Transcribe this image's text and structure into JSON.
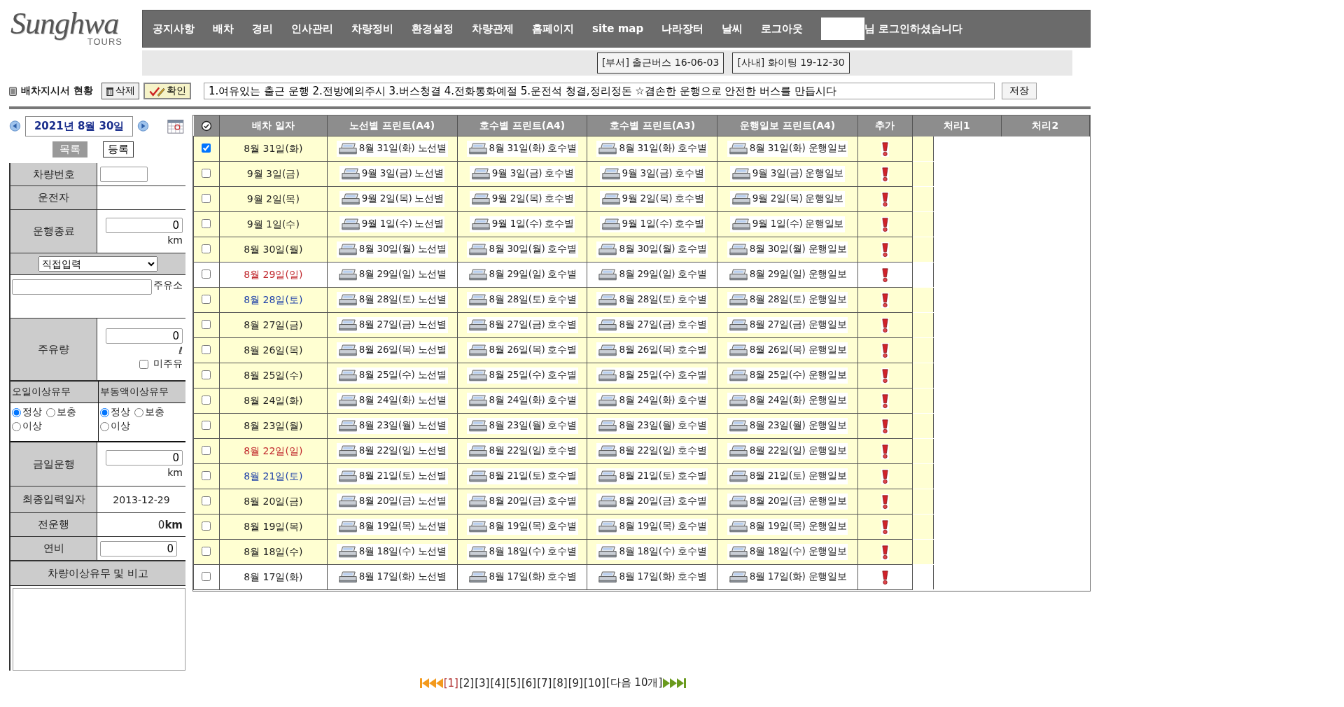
{
  "logo": {
    "name": "Sunghwa",
    "sub": "TOURS"
  },
  "nav": {
    "items": [
      "공지사항",
      "배차",
      "경리",
      "인사관리",
      "차량정비",
      "환경설정",
      "차량관제",
      "홈페이지",
      "site map",
      "나라장터",
      "날씨",
      "로그아웃"
    ],
    "login_text": "님 로그인하셨습니다"
  },
  "notices": [
    "[부서] 출근버스 16-06-03",
    "[사내] 화이팅 19-12-30"
  ],
  "toolbar": {
    "title": "배차지시서 현황",
    "delete": "삭제",
    "confirm": "확인",
    "motto": "1.여유있는 출근 운행 2.전방예의주시 3.버스청결 4.전화통화예절 5.운전석 청결,정리정돈 ☆겸손한 운행으로 안전한 버스를 만듭시다",
    "save": "저장"
  },
  "sidebar": {
    "date": "2021년 8월 30일",
    "list_button": "목록",
    "register_button": "등록",
    "vehicle_label": "차량번호",
    "driver_label": "운전자",
    "end_label": "운행종료",
    "end_value": "0",
    "end_unit": "km",
    "station_select": "직접입력",
    "station_suffix": "주유소",
    "fuel_label": "주유량",
    "fuel_value": "0",
    "fuel_unit": "ℓ",
    "no_fuel": {
      "label": "미주유",
      "checked": false
    },
    "checks": [
      {
        "title": "오일이상유무",
        "options": [
          {
            "label": "정상",
            "selected": true
          },
          {
            "label": "보충",
            "selected": false
          },
          {
            "label": "이상",
            "selected": false
          }
        ]
      },
      {
        "title": "부동액이상유무",
        "options": [
          {
            "label": "정상",
            "selected": true
          },
          {
            "label": "보충",
            "selected": false
          },
          {
            "label": "이상",
            "selected": false
          }
        ]
      }
    ],
    "today_label": "금일운행",
    "today_value": "0",
    "today_unit": "km",
    "last_label": "최종입력일자",
    "last_value": "2013-12-29",
    "prev_label": "전운행",
    "prev_value": "0**km**",
    "eff_label": "연비",
    "eff_value": "0",
    "remarks_label": "차량이상유무 및 비고"
  },
  "table": {
    "columns": [
      "배차 일자",
      "노선별 프린트(A4)",
      "호수별 프린트(A4)",
      "호수별 프린트(A3)",
      "운행일보 프린트(A4)",
      "추가",
      "처리1",
      "처리2"
    ],
    "rows": [
      {
        "date": "8월 31일(화)",
        "color": "#222222",
        "checked": true,
        "shaded": true,
        "prints": [
          "8월 31일(화) 노선별",
          "8월 31일(화) 호수별",
          "8월 31일(화) 호수별",
          "8월 31일(화) 운행일보"
        ]
      },
      {
        "date": "9월 3일(금)",
        "color": "#222222",
        "checked": false,
        "shaded": true,
        "prints": [
          "9월 3일(금) 노선별",
          "9월 3일(금) 호수별",
          "9월 3일(금) 호수별",
          "9월 3일(금) 운행일보"
        ]
      },
      {
        "date": "9월 2일(목)",
        "color": "#222222",
        "checked": false,
        "shaded": true,
        "prints": [
          "9월 2일(목) 노선별",
          "9월 2일(목) 호수별",
          "9월 2일(목) 호수별",
          "9월 2일(목) 운행일보"
        ]
      },
      {
        "date": "9월 1일(수)",
        "color": "#222222",
        "checked": false,
        "shaded": true,
        "prints": [
          "9월 1일(수) 노선별",
          "9월 1일(수) 호수별",
          "9월 1일(수) 호수별",
          "9월 1일(수) 운행일보"
        ]
      },
      {
        "date": "8월 30일(월)",
        "color": "#222222",
        "checked": false,
        "shaded": true,
        "prints": [
          "8월 30일(월) 노선별",
          "8월 30일(월) 호수별",
          "8월 30일(월) 호수별",
          "8월 30일(월) 운행일보"
        ]
      },
      {
        "date": "8월 29일(일)",
        "color": "#c0282d",
        "checked": false,
        "shaded": false,
        "prints": [
          "8월 29일(일) 노선별",
          "8월 29일(일) 호수별",
          "8월 29일(일) 호수별",
          "8월 29일(일) 운행일보"
        ]
      },
      {
        "date": "8월 28일(토)",
        "color": "#1d3fa8",
        "checked": false,
        "shaded": true,
        "prints": [
          "8월 28일(토) 노선별",
          "8월 28일(토) 호수별",
          "8월 28일(토) 호수별",
          "8월 28일(토) 운행일보"
        ]
      },
      {
        "date": "8월 27일(금)",
        "color": "#222222",
        "checked": false,
        "shaded": true,
        "prints": [
          "8월 27일(금) 노선별",
          "8월 27일(금) 호수별",
          "8월 27일(금) 호수별",
          "8월 27일(금) 운행일보"
        ]
      },
      {
        "date": "8월 26일(목)",
        "color": "#222222",
        "checked": false,
        "shaded": true,
        "prints": [
          "8월 26일(목) 노선별",
          "8월 26일(목) 호수별",
          "8월 26일(목) 호수별",
          "8월 26일(목) 운행일보"
        ]
      },
      {
        "date": "8월 25일(수)",
        "color": "#222222",
        "checked": false,
        "shaded": true,
        "prints": [
          "8월 25일(수) 노선별",
          "8월 25일(수) 호수별",
          "8월 25일(수) 호수별",
          "8월 25일(수) 운행일보"
        ]
      },
      {
        "date": "8월 24일(화)",
        "color": "#222222",
        "checked": false,
        "shaded": true,
        "prints": [
          "8월 24일(화) 노선별",
          "8월 24일(화) 호수별",
          "8월 24일(화) 호수별",
          "8월 24일(화) 운행일보"
        ]
      },
      {
        "date": "8월 23일(월)",
        "color": "#222222",
        "checked": false,
        "shaded": true,
        "prints": [
          "8월 23일(월) 노선별",
          "8월 23일(월) 호수별",
          "8월 23일(월) 호수별",
          "8월 23일(월) 운행일보"
        ]
      },
      {
        "date": "8월 22일(일)",
        "color": "#c0282d",
        "checked": false,
        "shaded": true,
        "prints": [
          "8월 22일(일) 노선별",
          "8월 22일(일) 호수별",
          "8월 22일(일) 호수별",
          "8월 22일(일) 운행일보"
        ]
      },
      {
        "date": "8월 21일(토)",
        "color": "#1d3fa8",
        "checked": false,
        "shaded": true,
        "prints": [
          "8월 21일(토) 노선별",
          "8월 21일(토) 호수별",
          "8월 21일(토) 호수별",
          "8월 21일(토) 운행일보"
        ]
      },
      {
        "date": "8월 20일(금)",
        "color": "#222222",
        "checked": false,
        "shaded": true,
        "prints": [
          "8월 20일(금) 노선별",
          "8월 20일(금) 호수별",
          "8월 20일(금) 호수별",
          "8월 20일(금) 운행일보"
        ]
      },
      {
        "date": "8월 19일(목)",
        "color": "#222222",
        "checked": false,
        "shaded": true,
        "prints": [
          "8월 19일(목) 노선별",
          "8월 19일(목) 호수별",
          "8월 19일(목) 호수별",
          "8월 19일(목) 운행일보"
        ]
      },
      {
        "date": "8월 18일(수)",
        "color": "#222222",
        "checked": false,
        "shaded": true,
        "prints": [
          "8월 18일(수) 노선별",
          "8월 18일(수) 호수별",
          "8월 18일(수) 호수별",
          "8월 18일(수) 운행일보"
        ]
      },
      {
        "date": "8월 17일(화)",
        "color": "#222222",
        "checked": false,
        "shaded": false,
        "prints": [
          "8월 17일(화) 노선별",
          "8월 17일(화) 호수별",
          "8월 17일(화) 호수별",
          "8월 17일(화) 운행일보"
        ]
      }
    ]
  },
  "pagination": {
    "pages": [
      {
        "label": "[1]",
        "selected": true
      },
      {
        "label": "[2]",
        "selected": false
      },
      {
        "label": "[3]",
        "selected": false
      },
      {
        "label": "[4]",
        "selected": false
      },
      {
        "label": "[5]",
        "selected": false
      },
      {
        "label": "[6]",
        "selected": false
      },
      {
        "label": "[7]",
        "selected": false
      },
      {
        "label": "[8]",
        "selected": false
      },
      {
        "label": "[9]",
        "selected": false
      },
      {
        "label": "[10]",
        "selected": false
      }
    ],
    "next": "[다음 10개]"
  }
}
